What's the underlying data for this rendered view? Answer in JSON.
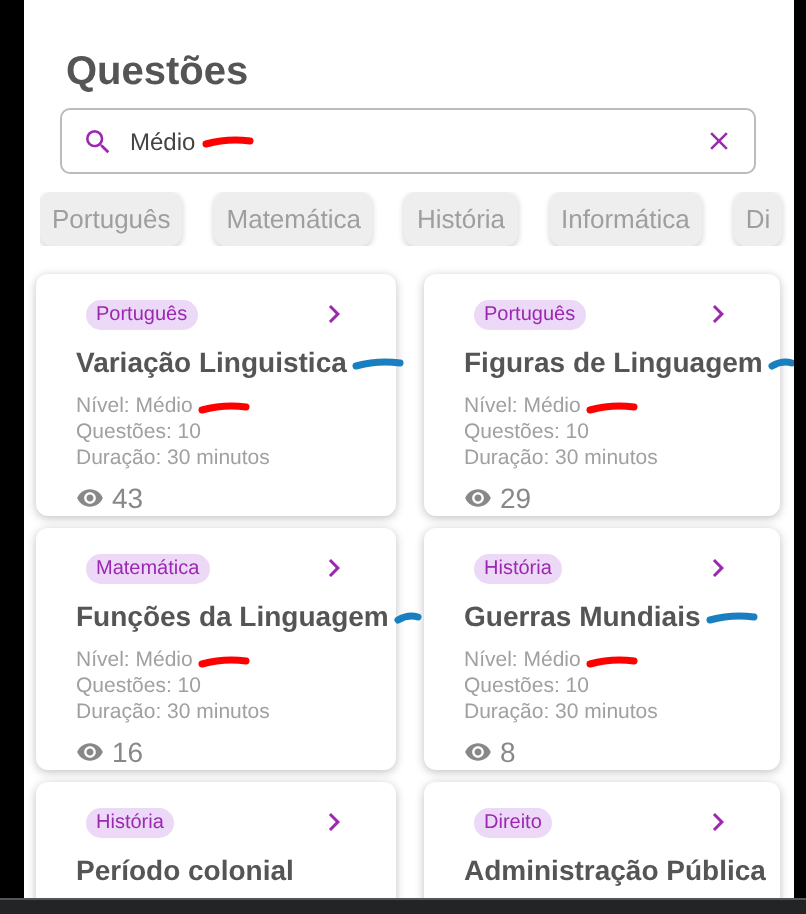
{
  "title": "Questões",
  "search": {
    "value": "Médio",
    "mark": {
      "color": "#ff0000"
    }
  },
  "filters": [
    {
      "label": "Português"
    },
    {
      "label": "Matemática"
    },
    {
      "label": "História"
    },
    {
      "label": "Informática"
    },
    {
      "label": "Di"
    }
  ],
  "cards": [
    {
      "subject": "Português",
      "title": "Variação Linguistica",
      "level": "Nível: Médio",
      "questions": "Questões: 10",
      "duration": "Duração: 30 minutos",
      "views": "43",
      "title_mark": {
        "color": "#1a7fc1"
      },
      "level_mark": {
        "color": "#ff0000"
      }
    },
    {
      "subject": "Português",
      "title": "Figuras de Linguagem",
      "level": "Nível: Médio",
      "questions": "Questões: 10",
      "duration": "Duração: 30 minutos",
      "views": "29",
      "title_mark": {
        "color": "#1a7fc1"
      },
      "level_mark": {
        "color": "#ff0000"
      }
    },
    {
      "subject": "Matemática",
      "title": "Funções da Linguagem",
      "level": "Nível: Médio",
      "questions": "Questões: 10",
      "duration": "Duração: 30 minutos",
      "views": "16",
      "title_mark": {
        "color": "#1a7fc1"
      },
      "level_mark": {
        "color": "#ff0000"
      }
    },
    {
      "subject": "História",
      "title": "Guerras Mundiais",
      "level": "Nível: Médio",
      "questions": "Questões: 10",
      "duration": "Duração: 30 minutos",
      "views": "8",
      "title_mark": {
        "color": "#1a7fc1"
      },
      "level_mark": {
        "color": "#ff0000"
      }
    },
    {
      "subject": "História",
      "title": "Período colonial"
    },
    {
      "subject": "Direito",
      "title": "Administração Pública"
    }
  ]
}
